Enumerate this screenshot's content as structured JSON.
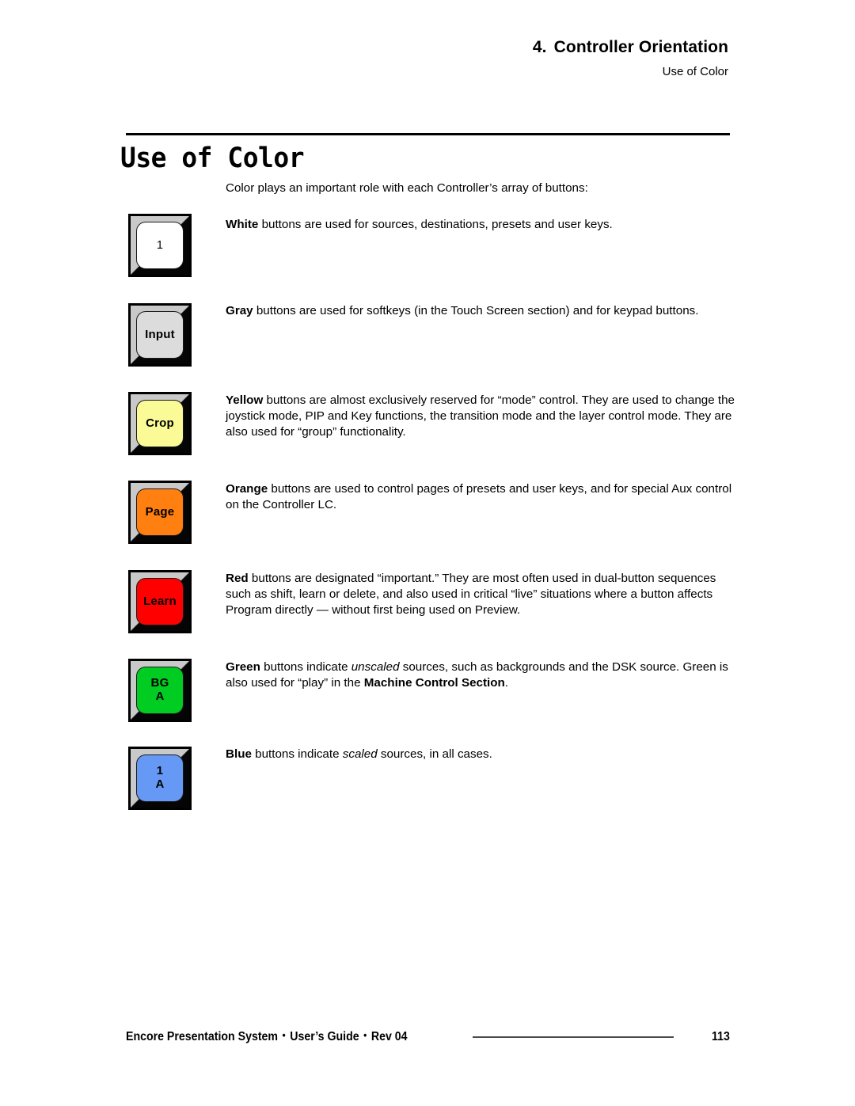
{
  "header": {
    "chapter_number": "4.",
    "chapter_title": "Controller Orientation",
    "section": "Use of Color"
  },
  "title": "Use of Color",
  "intro": "Color plays an important role with each Controller’s array of buttons:",
  "sections": [
    {
      "id": "white",
      "button": {
        "name": "white-button",
        "cap_color": "#ffffff",
        "text_color": "#000000",
        "lines": [
          "1"
        ],
        "bold": false
      },
      "text_lead": "White",
      "text_rest": " buttons are used for sources, destinations, presets and user keys."
    },
    {
      "id": "gray",
      "button": {
        "name": "gray-button",
        "cap_color": "#dcdcdc",
        "text_color": "#000000",
        "lines": [
          "Input"
        ],
        "bold": true
      },
      "text_lead": "Gray",
      "text_rest": " buttons are used for softkeys (in the Touch Screen section) and for keypad buttons."
    },
    {
      "id": "yellow",
      "button": {
        "name": "yellow-button",
        "cap_color": "#fafa96",
        "text_color": "#000000",
        "lines": [
          "Crop"
        ],
        "bold": true
      },
      "text_lead": "Yellow",
      "text_rest": " buttons are almost exclusively reserved for “mode” control.  They are used to change the joystick mode, PIP and Key functions, the transition mode and the layer control mode.  They are also used for “group” functionality."
    },
    {
      "id": "orange",
      "button": {
        "name": "orange-button",
        "cap_color": "#ff7f11",
        "text_color": "#000000",
        "lines": [
          "Page"
        ],
        "bold": true
      },
      "text_lead": "Orange",
      "text_rest": " buttons are used to control pages of presets and user keys, and for special Aux control on the Controller LC."
    },
    {
      "id": "red",
      "button": {
        "name": "red-button",
        "cap_color": "#ff0000",
        "text_color": "#000000",
        "lines": [
          "Learn"
        ],
        "bold": true
      },
      "text_lead": "Red",
      "text_rest": " buttons are designated “important.”  They are most often used in dual-button sequences such as shift, learn or delete, and also used in critical “live” situations where a button affects Program directly — without first being used on Preview."
    },
    {
      "id": "green",
      "button": {
        "name": "green-button",
        "cap_color": "#00cc22",
        "text_color": "#000000",
        "lines": [
          "BG",
          "A"
        ],
        "bold": true
      },
      "text_lead": "Green",
      "text_rest": " buttons indicate unscaled sources, such as backgrounds and the DSK source. Green is also used for “play” in the Machine Control Section."
    },
    {
      "id": "blue",
      "button": {
        "name": "blue-button",
        "cap_color": "#6699f5",
        "text_color": "#000000",
        "lines": [
          "1",
          "A"
        ],
        "bold": true
      },
      "text_lead": "Blue",
      "text_rest": " buttons indicate scaled sources, in all cases."
    }
  ],
  "paragraph_text": {
    "white": {
      "lead": "White",
      "rest": " buttons are used for sources, destinations, presets and user keys."
    },
    "gray": {
      "lead": "Gray",
      "rest": " buttons are used for softkeys (in the Touch Screen section) and for keypad buttons."
    },
    "yellow": {
      "lead": "Yellow",
      "rest": " buttons are almost exclusively reserved for “mode” control.  They are used to change the joystick mode, PIP and Key functions, the transition mode and the layer control mode.  They are also used for “group” functionality."
    },
    "orange": {
      "lead": "Orange",
      "rest": " buttons are used to control pages of presets and user keys, and for special Aux control on the Controller LC."
    },
    "red": {
      "lead": "Red",
      "rest": " buttons are designated “important.”  They are most often used in dual-button sequences such as shift, learn or delete, and also used in critical “live” situations where a button affects Program directly — without first being used on Preview."
    },
    "green": {
      "lead": "Green",
      "mid1": " buttons indicate ",
      "em1": "unscaled",
      "mid2": " sources, such as backgrounds and the DSK source. Green is also used for “play” in the ",
      "strong1": "Machine Control Section",
      "tail": "."
    },
    "blue": {
      "lead": "Blue",
      "mid1": " buttons indicate ",
      "em1": "scaled",
      "tail": " sources, in all cases."
    }
  },
  "footer": {
    "product": "Encore Presentation System",
    "separator": "•",
    "doc": "User’s Guide",
    "revision": "Rev 04",
    "page_number": "113"
  }
}
